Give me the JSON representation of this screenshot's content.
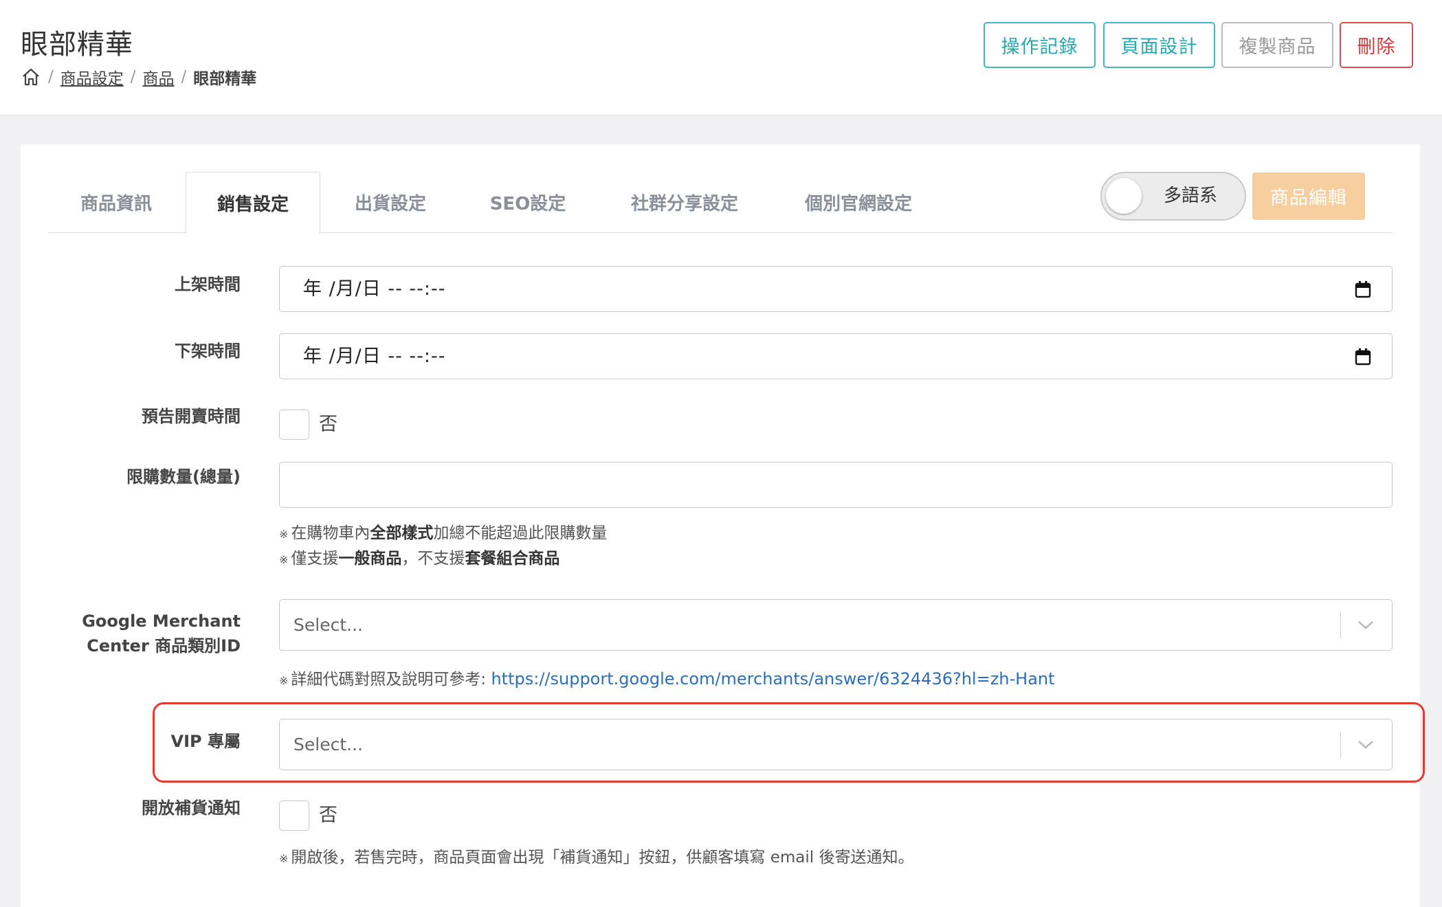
{
  "header": {
    "title": "眼部精華",
    "breadcrumb": {
      "home_icon": "home-icon",
      "items": [
        "商品設定",
        "商品"
      ],
      "current": "眼部精華",
      "separator": "/"
    },
    "buttons": {
      "log": "操作記錄",
      "design": "頁面設計",
      "copy": "複製商品",
      "delete": "刪除"
    }
  },
  "tabs": [
    "商品資訊",
    "銷售設定",
    "出貨設定",
    "SEO設定",
    "社群分享設定",
    "個別官網設定"
  ],
  "active_tab": "銷售設定",
  "multilang": {
    "label": "多語系",
    "enabled": false
  },
  "edit_button": "商品編輯",
  "form": {
    "launch_time": {
      "label": "上架時間",
      "value": "年 /月/日 -- --:--"
    },
    "unlaunch_time": {
      "label": "下架時間",
      "value": "年 /月/日 -- --:--"
    },
    "preorder": {
      "label": "預告開賣時間",
      "checked": false,
      "option": "否"
    },
    "limit": {
      "label": "限購數量(總量)",
      "value": "",
      "note1": {
        "mark": "※",
        "a": "在購物車內",
        "b": "全部樣式",
        "c": "加總不能超過此限購數量"
      },
      "note2": {
        "mark": "※",
        "a": "僅支援",
        "b": "一般商品",
        "c": "，不支援",
        "d": "套餐組合商品"
      }
    },
    "gmc": {
      "label_line1": "Google Merchant",
      "label_line2": "Center 商品類別ID",
      "placeholder": "Select...",
      "note_mark": "※",
      "note": "詳細代碼對照及說明可參考: ",
      "link": "https://support.google.com/merchants/answer/6324436?hl=zh-Hant"
    },
    "vip": {
      "label": "VIP 專屬",
      "placeholder": "Select..."
    },
    "restock": {
      "label": "開放補貨通知",
      "checked": false,
      "option": "否",
      "note_mark": "※",
      "note": "開啟後，若售完時，商品頁面會出現「補貨通知」按鈕，供顧客填寫 email 後寄送通知。"
    }
  },
  "colors": {
    "teal": "#2aa6ae",
    "danger": "#d9363b",
    "edit_button_bg": "#f7cf9f",
    "highlight": "#e23b30",
    "link": "#2c6fb7"
  }
}
